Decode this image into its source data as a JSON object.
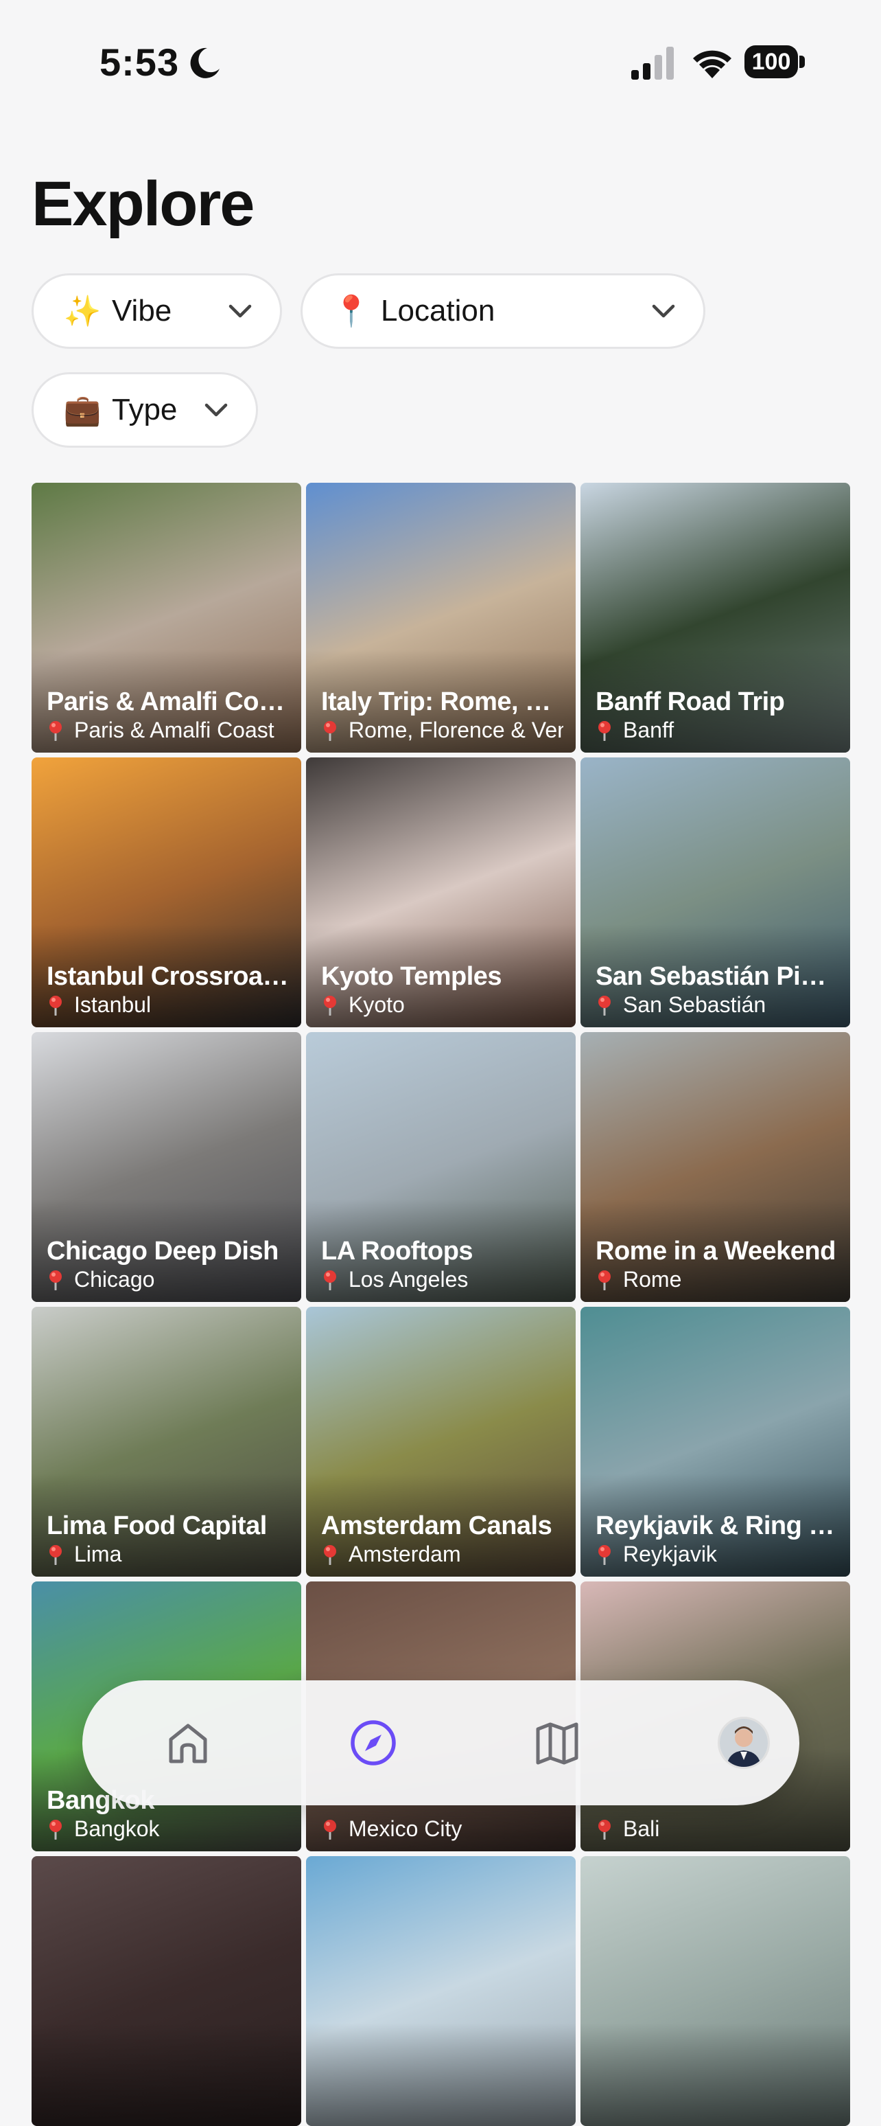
{
  "status_bar": {
    "time": "5:53",
    "battery": "100"
  },
  "header": {
    "title": "Explore"
  },
  "filters": [
    {
      "emoji": "✨",
      "label": "Vibe"
    },
    {
      "emoji": "📍",
      "label": "Location"
    },
    {
      "emoji": "💼",
      "label": "Type"
    }
  ],
  "cards": [
    {
      "title": "Paris & Amalfi Coast",
      "location": "Paris & Amalfi Coast",
      "palette": [
        "#5e7a45",
        "#b7a89a",
        "#8b6a52"
      ]
    },
    {
      "title": "Italy Trip: Rome, Florence & Venice",
      "location": "Rome, Florence & Venice",
      "palette": [
        "#5f8fd0",
        "#c7b39a",
        "#8a6c52"
      ]
    },
    {
      "title": "Banff Road Trip",
      "location": "Banff",
      "palette": [
        "#c9d6e2",
        "#32452f",
        "#6c7a78"
      ]
    },
    {
      "title": "Istanbul Crossroads",
      "location": "Istanbul",
      "palette": [
        "#f1a33c",
        "#a5642f",
        "#2c2a2b"
      ]
    },
    {
      "title": "Kyoto Temples",
      "location": "Kyoto",
      "palette": [
        "#3f3a39",
        "#d9c9c3",
        "#6f4d3e"
      ]
    },
    {
      "title": "San Sebastián Pintxos",
      "location": "San Sebastián",
      "palette": [
        "#9ab4c8",
        "#7b8f84",
        "#3d5a6b"
      ]
    },
    {
      "title": "Chicago Deep Dish",
      "location": "Chicago",
      "palette": [
        "#d8dade",
        "#7c7a78",
        "#4c4d52"
      ]
    },
    {
      "title": "LA Rooftops",
      "location": "Los Angeles",
      "palette": [
        "#b9cbd9",
        "#9faab2",
        "#4e5a4f"
      ]
    },
    {
      "title": "Rome in a Weekend",
      "location": "Rome",
      "palette": [
        "#a6b0b4",
        "#8b6b4f",
        "#3e3a33"
      ]
    },
    {
      "title": "Lima Food Capital",
      "location": "Lima",
      "palette": [
        "#c9ccc9",
        "#6f7c57",
        "#4b4a3f"
      ]
    },
    {
      "title": "Amsterdam Canals",
      "location": "Amsterdam",
      "palette": [
        "#a9c6d8",
        "#8a8b4a",
        "#5b4a3a"
      ]
    },
    {
      "title": "Reykjavik & Ring Road",
      "location": "Reykjavik",
      "palette": [
        "#4f8e93",
        "#8aa4ac",
        "#334c56"
      ]
    },
    {
      "title": "Bangkok",
      "location": "Bangkok",
      "palette": [
        "#4a8fa7",
        "#5aa84b",
        "#4b4a45"
      ]
    },
    {
      "title": "",
      "location": "Mexico City",
      "palette": [
        "#6b5045",
        "#8b6d5c",
        "#3f2f2b"
      ]
    },
    {
      "title": "",
      "location": "Bali",
      "palette": [
        "#d8b8b7",
        "#6e6d55",
        "#4d4f3f"
      ]
    },
    {
      "title": "",
      "location": "",
      "palette": [
        "#5b4a4a",
        "#3a2b2b",
        "#2a2020"
      ]
    },
    {
      "title": "",
      "location": "",
      "palette": [
        "#6aa9d4",
        "#c8d8e2",
        "#9aa6ad"
      ]
    },
    {
      "title": "",
      "location": "",
      "palette": [
        "#c6d2cf",
        "#9aaaa5",
        "#6a7a76"
      ]
    }
  ],
  "tab_bar": {
    "items": [
      "home-icon",
      "compass-icon",
      "map-icon",
      "avatar"
    ],
    "active": "compass-icon",
    "accent": "#6b4cf6"
  }
}
